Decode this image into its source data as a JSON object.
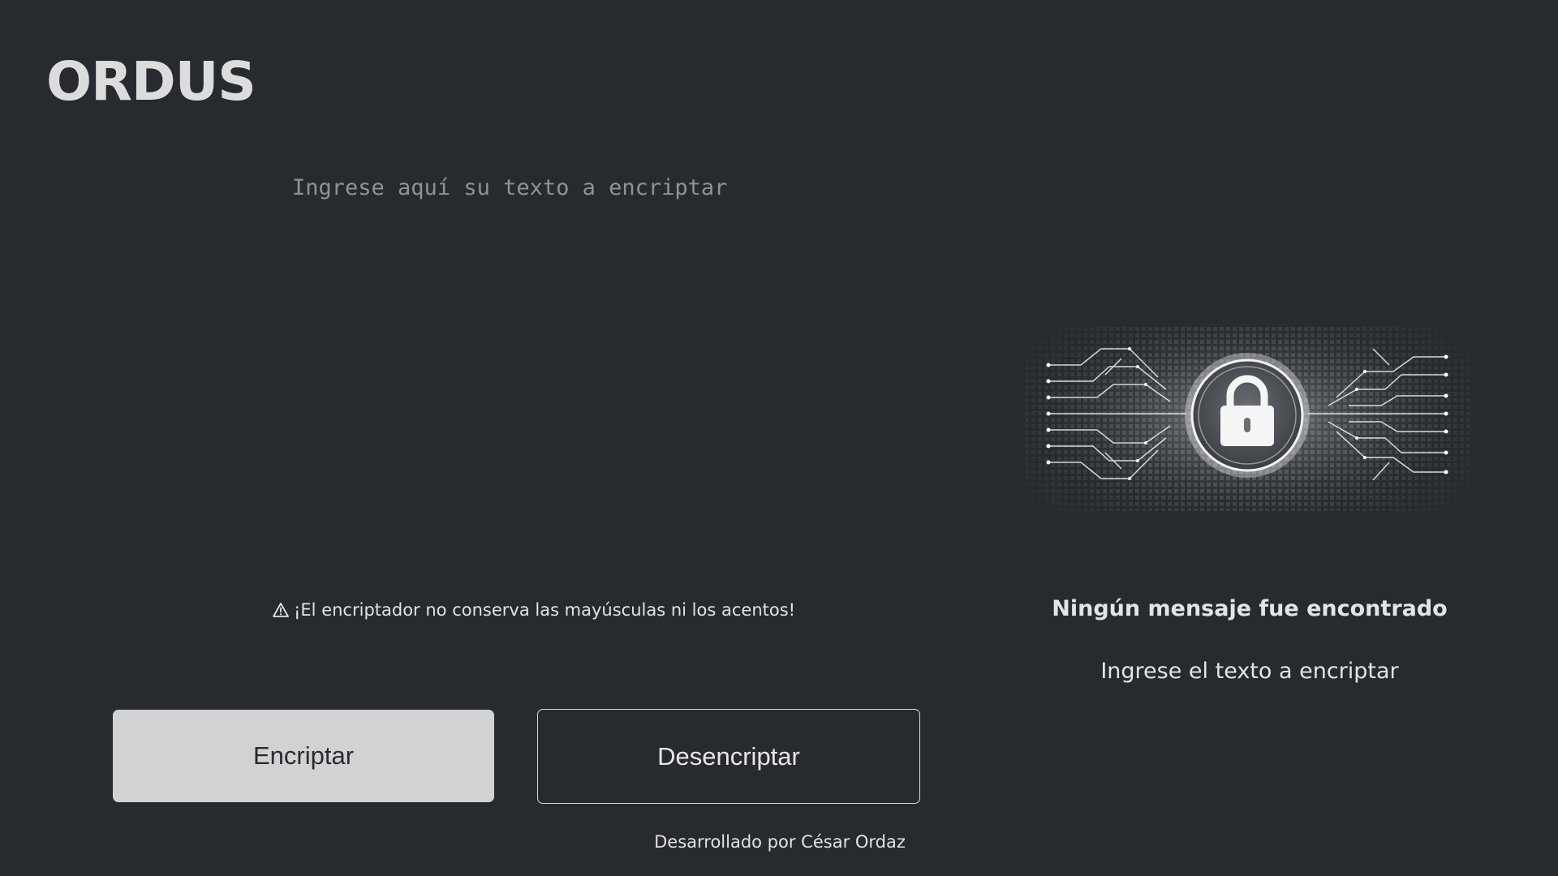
{
  "app": {
    "logo": "ORDUS"
  },
  "input": {
    "placeholder": "Ingrese aquí su texto a encriptar",
    "value": ""
  },
  "warning": {
    "icon": "warning-triangle-icon",
    "text": "¡El encriptador no conserva las mayúsculas ni los acentos!"
  },
  "buttons": {
    "encrypt_label": "Encriptar",
    "decrypt_label": "Desencriptar"
  },
  "result": {
    "illustration_icon": "lock-circuit-icon",
    "title": "Ningún mensaje fue encontrado",
    "subtitle": "Ingrese el texto a encriptar"
  },
  "footer": {
    "credit": "Desarrollado por César Ordaz"
  },
  "colors": {
    "background": "#272b30",
    "primary_button": "#d2d2d2",
    "text": "#e6e6e6"
  }
}
